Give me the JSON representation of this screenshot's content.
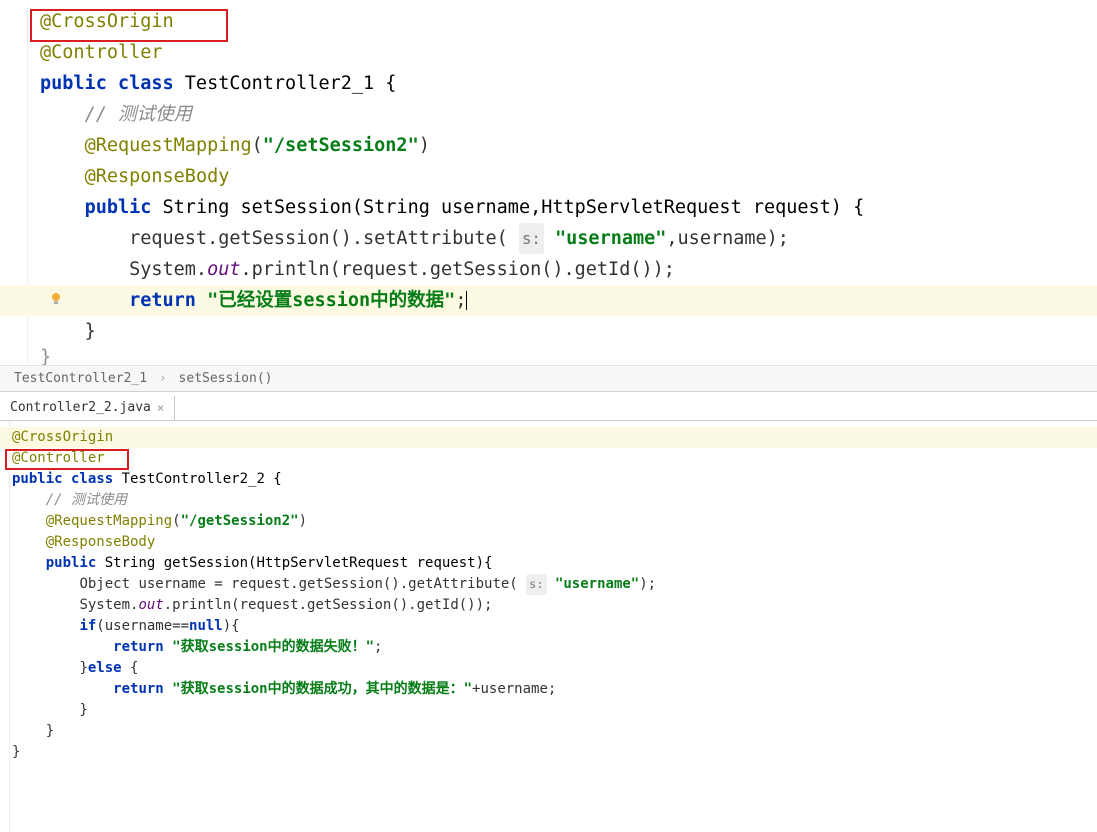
{
  "topPane": {
    "lines": [
      {
        "tokens": [
          {
            "cls": "ann",
            "t": "@CrossOrigin"
          }
        ],
        "redbox": true
      },
      {
        "tokens": [
          {
            "cls": "ann",
            "t": "@Controller"
          }
        ]
      },
      {
        "tokens": [
          {
            "cls": "kw",
            "t": "public class "
          },
          {
            "cls": "type",
            "t": "TestController2_1 {"
          }
        ]
      },
      {
        "indent": 1,
        "tokens": [
          {
            "cls": "cmt",
            "t": "// 测试使用"
          }
        ]
      },
      {
        "indent": 1,
        "tokens": [
          {
            "cls": "ann",
            "t": "@RequestMapping"
          },
          {
            "cls": "",
            "t": "("
          },
          {
            "cls": "str",
            "t": "\"/setSession2\""
          },
          {
            "cls": "",
            "t": ")"
          }
        ]
      },
      {
        "indent": 1,
        "tokens": [
          {
            "cls": "ann",
            "t": "@ResponseBody"
          }
        ]
      },
      {
        "indent": 1,
        "tokens": [
          {
            "cls": "kw",
            "t": "public "
          },
          {
            "cls": "type",
            "t": "String setSession(String username,HttpServletRequest request) {"
          }
        ]
      },
      {
        "indent": 2,
        "tokens": [
          {
            "cls": "",
            "t": "request.getSession().setAttribute( "
          },
          {
            "cls": "param-hint",
            "t": "s:"
          },
          {
            "cls": "",
            "t": " "
          },
          {
            "cls": "str",
            "t": "\"username\""
          },
          {
            "cls": "",
            "t": ",username);"
          }
        ]
      },
      {
        "indent": 2,
        "tokens": [
          {
            "cls": "",
            "t": "System."
          },
          {
            "cls": "field",
            "t": "out"
          },
          {
            "cls": "",
            "t": ".println(request.getSession().getId());"
          }
        ]
      },
      {
        "indent": 2,
        "highlight": true,
        "tokens": [
          {
            "cls": "kw",
            "t": "return "
          },
          {
            "cls": "str",
            "t": "\"已经设置session中的数据\""
          },
          {
            "cls": "",
            "t": ";"
          }
        ],
        "cursor": true,
        "bulb": true
      },
      {
        "indent": 1,
        "tokens": [
          {
            "cls": "",
            "t": "}"
          }
        ]
      },
      {
        "indent": 0,
        "tokens": [
          {
            "cls": "",
            "t": "}"
          }
        ],
        "faded": true
      }
    ],
    "breadcrumb": {
      "class": "TestController2_1",
      "method": "setSession()"
    }
  },
  "bottomTab": {
    "name": "Controller2_2.java"
  },
  "bottomPane": {
    "lines": [
      {
        "tokens": [
          {
            "cls": "",
            "t": ""
          }
        ]
      },
      {
        "highlight": true,
        "redbox": true,
        "tokens": [
          {
            "cls": "ann",
            "t": "@CrossOrigin"
          }
        ]
      },
      {
        "tokens": [
          {
            "cls": "ann",
            "t": "@Controller"
          }
        ]
      },
      {
        "tokens": [
          {
            "cls": "kw",
            "t": "public class "
          },
          {
            "cls": "type",
            "t": "TestController2_2 {"
          }
        ]
      },
      {
        "indent": 1,
        "tokens": [
          {
            "cls": "cmt",
            "t": "// 测试使用"
          }
        ]
      },
      {
        "indent": 1,
        "tokens": [
          {
            "cls": "ann",
            "t": "@RequestMapping"
          },
          {
            "cls": "",
            "t": "("
          },
          {
            "cls": "str",
            "t": "\"/getSession2\""
          },
          {
            "cls": "",
            "t": ")"
          }
        ]
      },
      {
        "indent": 1,
        "tokens": [
          {
            "cls": "ann",
            "t": "@ResponseBody"
          }
        ]
      },
      {
        "indent": 1,
        "tokens": [
          {
            "cls": "kw",
            "t": "public "
          },
          {
            "cls": "type",
            "t": "String getSession(HttpServletRequest request){"
          }
        ]
      },
      {
        "indent": 2,
        "tokens": [
          {
            "cls": "",
            "t": "Object username = request.getSession().getAttribute( "
          },
          {
            "cls": "param-hint",
            "t": "s:"
          },
          {
            "cls": "",
            "t": " "
          },
          {
            "cls": "str",
            "t": "\"username\""
          },
          {
            "cls": "",
            "t": ");"
          }
        ]
      },
      {
        "indent": 2,
        "tokens": [
          {
            "cls": "",
            "t": "System."
          },
          {
            "cls": "field",
            "t": "out"
          },
          {
            "cls": "",
            "t": ".println(request.getSession().getId());"
          }
        ]
      },
      {
        "indent": 2,
        "tokens": [
          {
            "cls": "kw",
            "t": "if"
          },
          {
            "cls": "",
            "t": "(username=="
          },
          {
            "cls": "kw",
            "t": "null"
          },
          {
            "cls": "",
            "t": "){"
          }
        ]
      },
      {
        "indent": 3,
        "tokens": [
          {
            "cls": "kw",
            "t": "return "
          },
          {
            "cls": "str",
            "t": "\"获取session中的数据失败！\""
          },
          {
            "cls": "",
            "t": ";"
          }
        ]
      },
      {
        "indent": 2,
        "tokens": [
          {
            "cls": "",
            "t": "}"
          },
          {
            "cls": "kw",
            "t": "else "
          },
          {
            "cls": "",
            "t": "{"
          }
        ]
      },
      {
        "indent": 3,
        "tokens": [
          {
            "cls": "kw",
            "t": "return "
          },
          {
            "cls": "str",
            "t": "\"获取session中的数据成功，其中的数据是：\""
          },
          {
            "cls": "",
            "t": "+username;"
          }
        ]
      },
      {
        "indent": 2,
        "tokens": [
          {
            "cls": "",
            "t": "}"
          }
        ]
      },
      {
        "indent": 1,
        "tokens": [
          {
            "cls": "",
            "t": "}"
          }
        ]
      },
      {
        "tokens": [
          {
            "cls": "",
            "t": "}"
          }
        ]
      }
    ]
  }
}
